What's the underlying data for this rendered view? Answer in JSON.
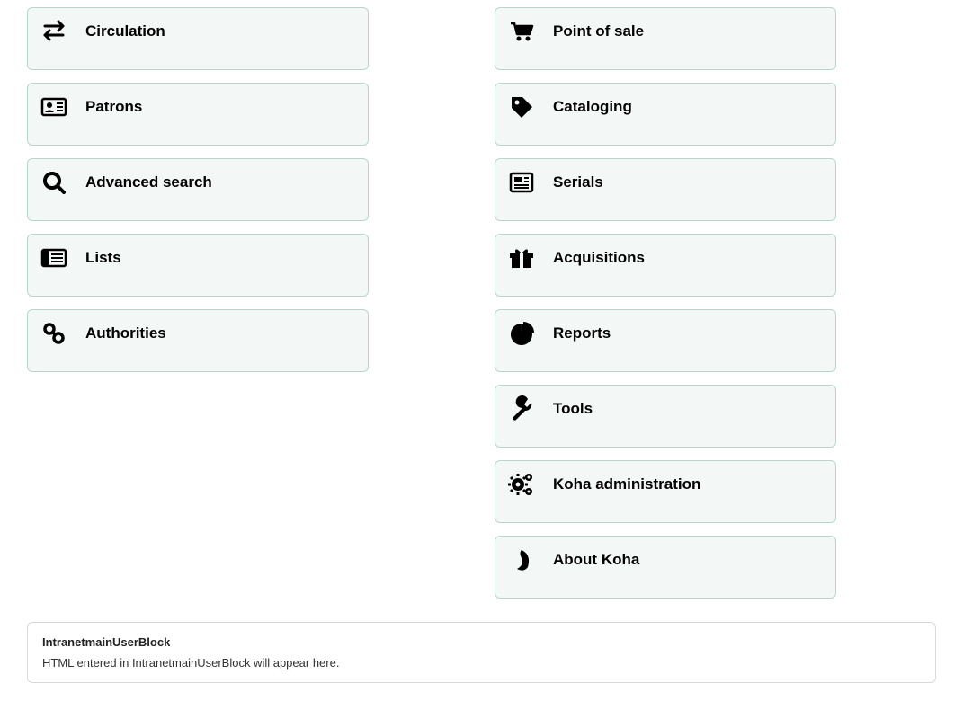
{
  "left_items": [
    {
      "id": "circulation",
      "label": "Circulation",
      "icon": "arrows-icon"
    },
    {
      "id": "patrons",
      "label": "Patrons",
      "icon": "id-card-icon"
    },
    {
      "id": "advanced-search",
      "label": "Advanced search",
      "icon": "search-icon"
    },
    {
      "id": "lists",
      "label": "Lists",
      "icon": "list-icon"
    },
    {
      "id": "authorities",
      "label": "Authorities",
      "icon": "link-icon"
    }
  ],
  "right_items": [
    {
      "id": "point-of-sale",
      "label": "Point of sale",
      "icon": "cart-icon"
    },
    {
      "id": "cataloging",
      "label": "Cataloging",
      "icon": "tag-icon"
    },
    {
      "id": "serials",
      "label": "Serials",
      "icon": "newspaper-icon"
    },
    {
      "id": "acquisitions",
      "label": "Acquisitions",
      "icon": "gift-icon"
    },
    {
      "id": "reports",
      "label": "Reports",
      "icon": "pie-chart-icon"
    },
    {
      "id": "tools",
      "label": "Tools",
      "icon": "wrench-icon"
    },
    {
      "id": "koha-administration",
      "label": "Koha administration",
      "icon": "gears-icon"
    },
    {
      "id": "about-koha",
      "label": "About Koha",
      "icon": "koha-logo-icon"
    }
  ],
  "user_block": {
    "title": "IntranetmainUserBlock",
    "body": "HTML entered in IntranetmainUserBlock will appear here."
  }
}
